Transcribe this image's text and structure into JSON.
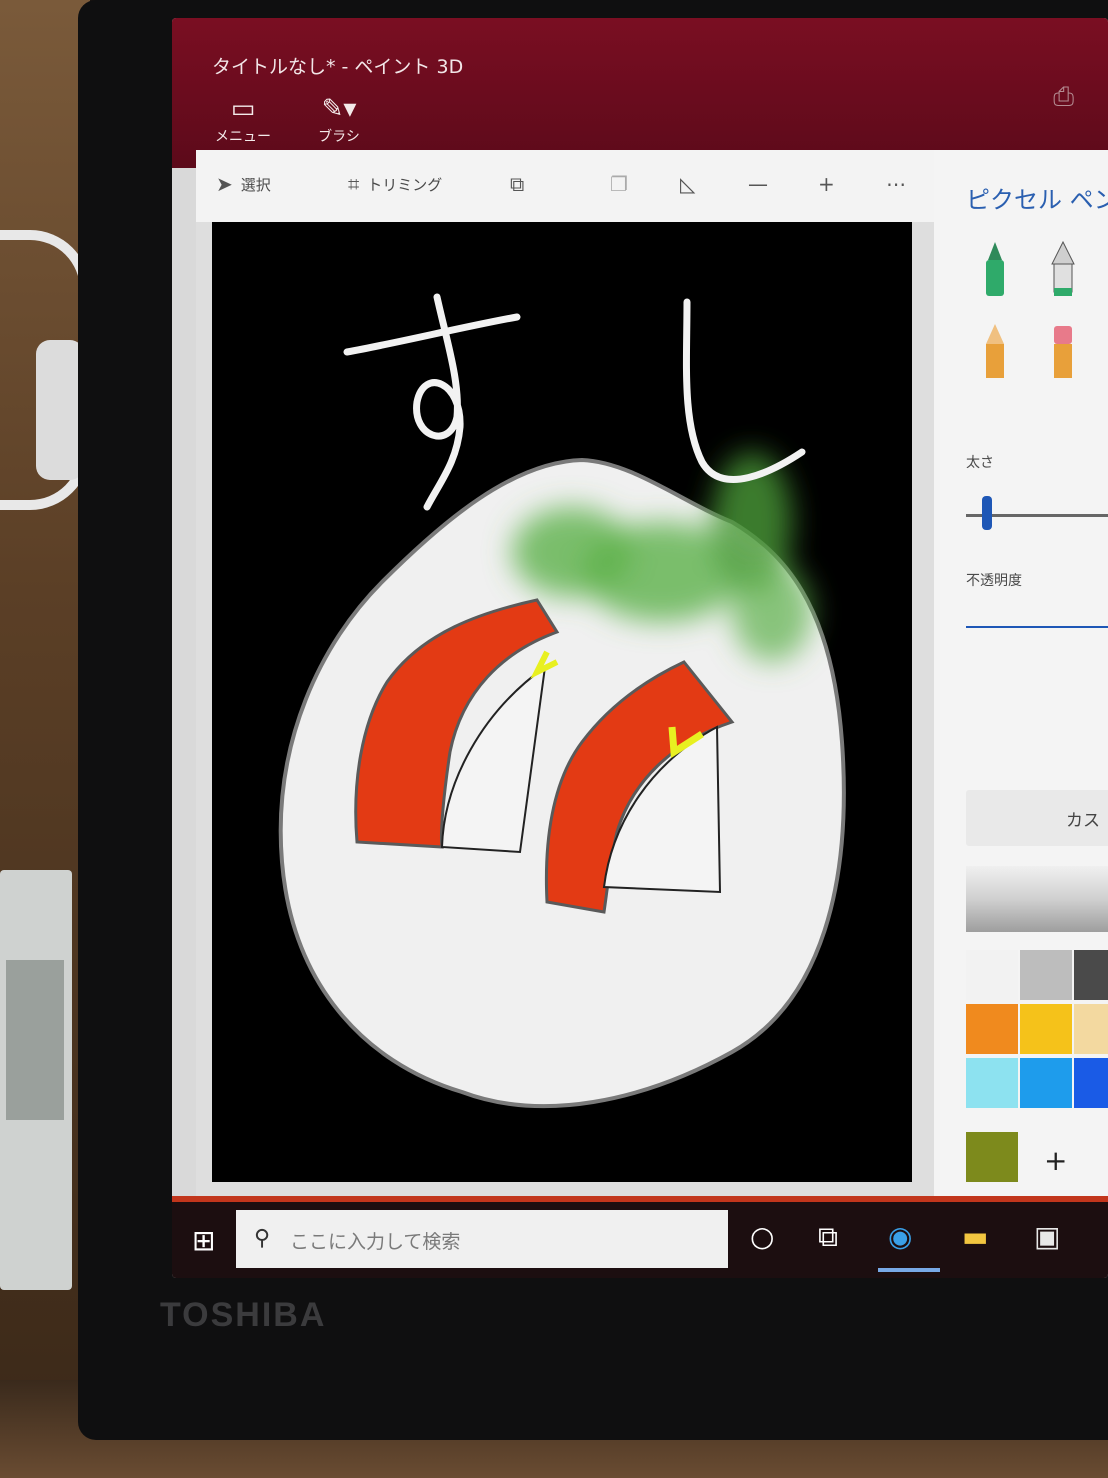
{
  "window": {
    "title": "タイトルなし* - ペイント 3D",
    "menu_label": "メニュー",
    "brush_label": "ブラシ"
  },
  "toolbar": {
    "select_label": "選択",
    "crop_label": "トリミング"
  },
  "panel": {
    "title": "ピクセル ペン",
    "thickness_label": "太さ",
    "opacity_label": "不透明度",
    "custom_label": "カス",
    "add_color": "+",
    "palette": [
      "#f2f2f2",
      "#bdbdbd",
      "#4a4a4a",
      "#f08a1e",
      "#f5c21a",
      "#f3d9a0",
      "#8de2f0",
      "#1e9cec",
      "#1a5be6",
      "#7d8a1c"
    ]
  },
  "canvas": {
    "text": "すし",
    "colors": {
      "background": "#000000",
      "rice": "#f0f0f0",
      "fish": "#e33a14",
      "accent": "#e8f020",
      "leaf": "#5cb14a"
    }
  },
  "taskbar": {
    "search_placeholder": "ここに入力して検索"
  },
  "bezel": {
    "brand": "TOSHIBA"
  }
}
